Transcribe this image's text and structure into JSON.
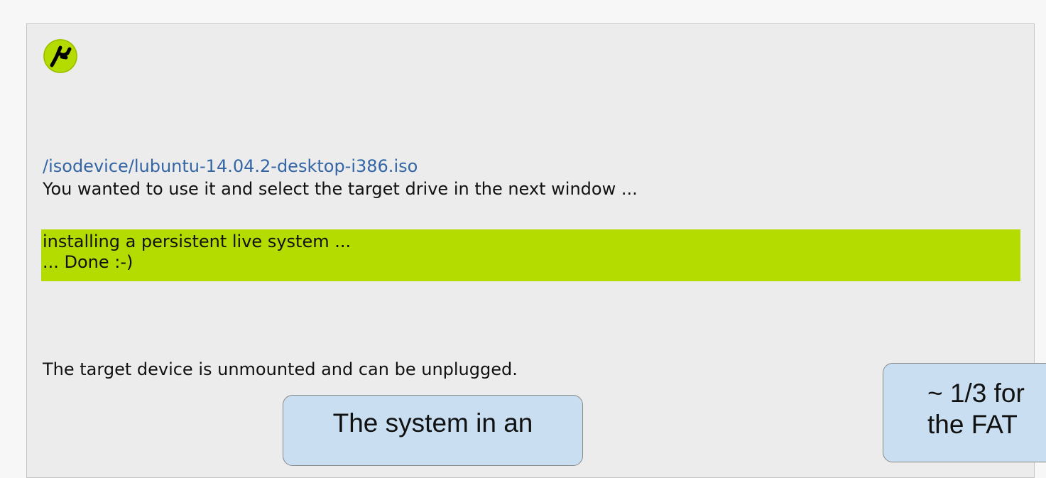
{
  "icons": {
    "app_icon": "usb-fork-icon"
  },
  "colors": {
    "link": "#3465a4",
    "highlight": "#b5dc00",
    "callout": "#c9dff1"
  },
  "dialog": {
    "iso_path": "/isodevice/lubuntu-14.04.2-desktop-i386.iso",
    "wanted_text": "You wanted to use it and select the target drive in the next window ...",
    "status_line1": "installing a persistent live system ...",
    "status_line2": "... Done :-)",
    "target_text": "The target device is unmounted and can be unplugged."
  },
  "callouts": {
    "left_text": "The system in an",
    "right_line1": "~ 1/3 for",
    "right_line2": "the FAT"
  }
}
